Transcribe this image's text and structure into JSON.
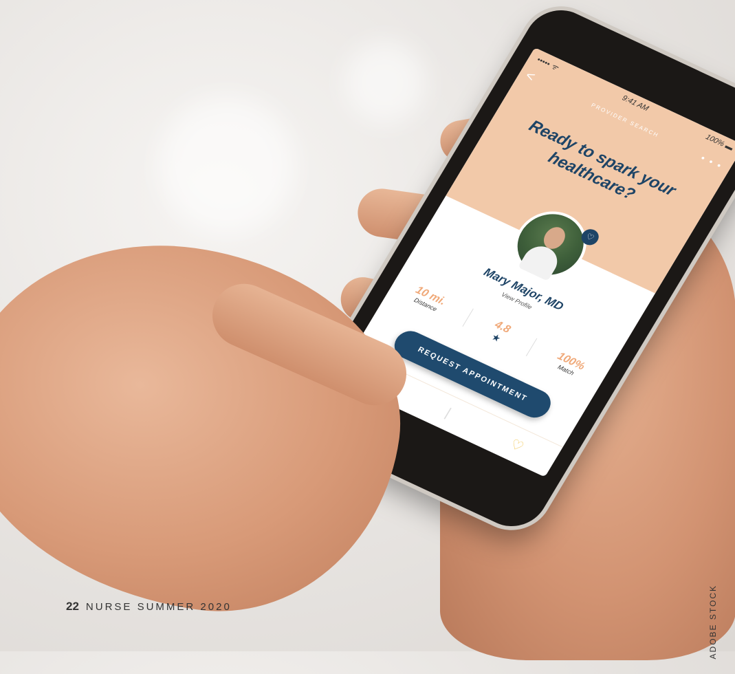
{
  "app": {
    "status_signal": "•••••  ᯤ",
    "status_time": "9:41 AM",
    "status_battery": "100% ▬",
    "back_glyph": "<",
    "nav_title": "PROVIDER SEARCH",
    "more_glyph": "• • •",
    "headline": "Ready to spark your healthcare?",
    "favorite_glyph": "♡",
    "provider_name": "Mary Major, MD",
    "view_profile": "View Profile",
    "stats": [
      {
        "value": "10 mi.",
        "label": "Distance"
      },
      {
        "value": "4.8",
        "label": "★"
      },
      {
        "value": "100%",
        "label": "Match"
      }
    ],
    "cta_label": "REQUEST APPOINTMENT",
    "tab_icons": [
      "⚲",
      "|",
      "♡"
    ]
  },
  "page": {
    "number": "22",
    "magazine": "NURSE SUMMER 2020",
    "credit": "ADOBE STOCK"
  },
  "colors": {
    "accent_peach": "#f2c9a9",
    "navy": "#1e4466",
    "stat_orange": "#f0a979",
    "tab_yellow": "#f2c95a"
  }
}
